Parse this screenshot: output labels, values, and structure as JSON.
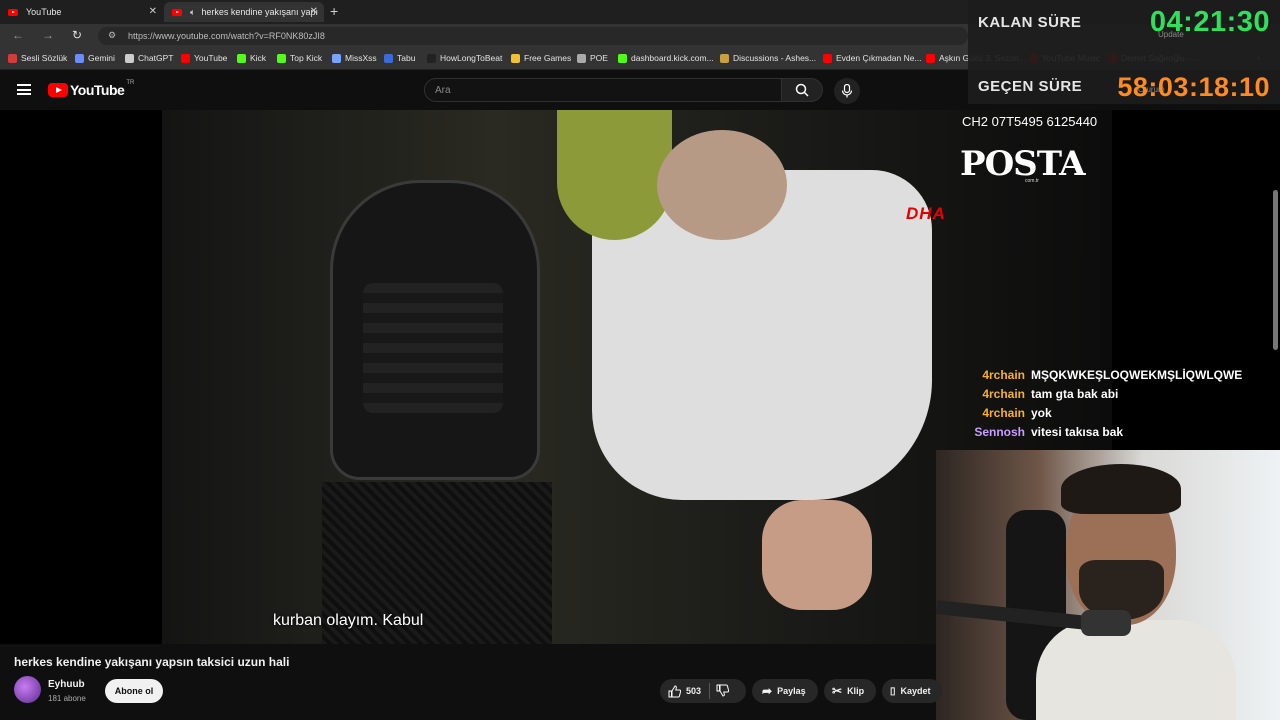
{
  "browser": {
    "tabs": [
      {
        "label": "YouTube"
      },
      {
        "label": "herkes kendine yakışanı yapı"
      }
    ],
    "url": "https://www.youtube.com/watch?v=RF0NK80zJI8",
    "bookmarks": [
      {
        "label": "Sesli Sözlük",
        "color": "#d43c3c"
      },
      {
        "label": "Gemini",
        "color": "#6a8cff"
      },
      {
        "label": "ChatGPT",
        "color": "#cccccc"
      },
      {
        "label": "YouTube",
        "color": "#ff0000"
      },
      {
        "label": "Kick",
        "color": "#53fc18"
      },
      {
        "label": "Top Kick",
        "color": "#53fc18"
      },
      {
        "label": "MissXss",
        "color": "#7aa2ff"
      },
      {
        "label": "Tabu",
        "color": "#3a6bd8"
      },
      {
        "label": "HowLongToBeat",
        "color": "#222222"
      },
      {
        "label": "Free Games",
        "color": "#f2c230"
      },
      {
        "label": "POE",
        "color": "#aaaaaa"
      },
      {
        "label": "dashboard.kick.com...",
        "color": "#53fc18"
      },
      {
        "label": "Discussions - Ashes...",
        "color": "#c8a040"
      },
      {
        "label": "Evden Çıkmadan Ne...",
        "color": "#ff0000"
      },
      {
        "label": "Aşkın Gücü 3. Sezon...",
        "color": "#ff0000"
      },
      {
        "label": "YouTube Music",
        "color": "#ff0000"
      },
      {
        "label": "Demet Sağıroğlu -...",
        "color": "#ff0000"
      }
    ]
  },
  "youtube": {
    "logo_text": "YouTube",
    "region": "TR",
    "search_placeholder": "Ara"
  },
  "overlay": {
    "remaining_label": "KALAN SÜRE",
    "remaining_value": "04:21:30",
    "elapsed_label": "GEÇEN SÜRE",
    "elapsed_value": "58:03:18:10",
    "update_label": "Update",
    "signin_label": "Oturum"
  },
  "video": {
    "channel_info": "CH2 07T5495 6125440",
    "watermark": "POSTA",
    "watermark_sub": "com.tr",
    "news_logo": "DHA",
    "subtitle": "kurban olayım. Kabul"
  },
  "chat": [
    {
      "user": "4rchain",
      "message": "MŞQKWKEŞLOQWEKMŞLİQWLQWE",
      "color": "#f5b02e"
    },
    {
      "user": "4rchain",
      "message": "tam gta bak abi",
      "color": "#f5b02e"
    },
    {
      "user": "4rchain",
      "message": "yok",
      "color": "#f5b02e"
    },
    {
      "user": "Sennosh",
      "message": "vitesi takısa bak",
      "color": "#c99cff"
    }
  ],
  "meta": {
    "title": "herkes kendine yakışanı yapsın taksici uzun hali",
    "channel": "Eyhuub",
    "subscribers": "181 abone",
    "subscribe_label": "Abone ol",
    "likes": "503",
    "share_label": "Paylaş",
    "clip_label": "Klip",
    "save_label": "Kaydet"
  }
}
